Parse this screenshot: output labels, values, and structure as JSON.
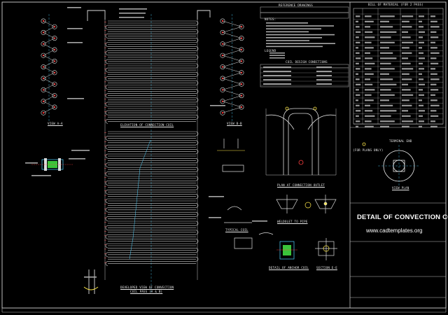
{
  "drawing": {
    "title": "DETAIL OF CONVECTION COIL",
    "website": "www.cadtemplates.org"
  },
  "labels": {
    "elevation": "ELEVATION OF CONNECTION COIL",
    "developed_view": "DEVELOPED VIEW OF CONVECTION",
    "coil_pass": "COIL PASS (A & B)",
    "view_aa": "VIEW A-A",
    "view_bb": "VIEW B-B",
    "plan_outlet": "PLAN AT CONNECTION OUTLET",
    "typical_coil": "TYPICAL COIL",
    "detail_anchor": "DETAIL OF ANCHOR COIL",
    "section_ee": "SECTION E-E",
    "weld_detail": "WELDOLET TO PIPE",
    "for_plans": "(FOR PLANS ONLY)",
    "terminal_end": "TERMINAL END",
    "view_plan": "VIEW PLAN",
    "bill_of_material": "BILL OF MATERIAL (FOR 2 PASS)",
    "reference_drawings": "REFERENCE DRAWINGS",
    "coil_design": "COIL DESIGN CONDITIONS",
    "notes": "NOTES:",
    "legend": "LEGEND"
  }
}
